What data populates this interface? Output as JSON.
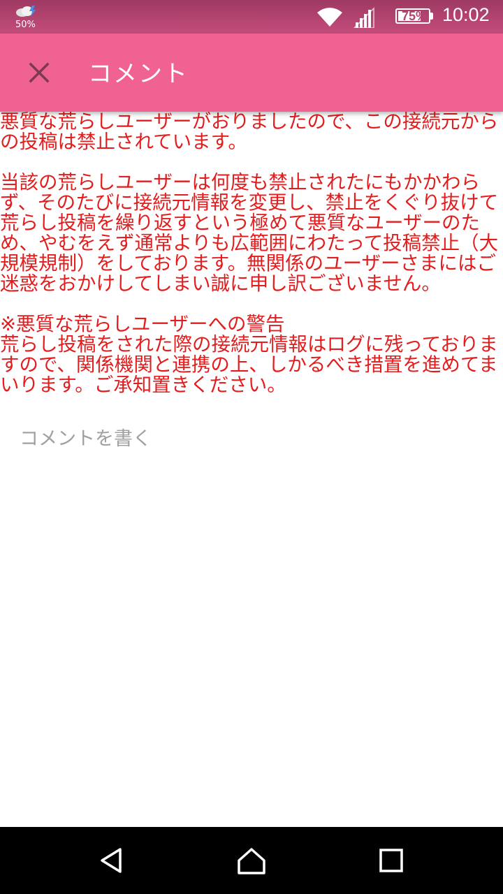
{
  "status_bar": {
    "weather_percent": "50%",
    "battery_percent": "75%",
    "battery_level": 0.75,
    "time": "10:02",
    "icons": [
      "weather-icon",
      "wifi-icon",
      "signal-icon",
      "battery-icon"
    ]
  },
  "app_bar": {
    "title": "コメント",
    "close_icon": "close-icon",
    "color": "#f06292"
  },
  "notice": {
    "color": "#e31d1d",
    "paragraph1": "悪質な荒らしユーザーがおりましたので、この接続元からの投稿は禁止されています。",
    "paragraph2": "当該の荒らしユーザーは何度も禁止されたにもかかわらず、そのたびに接続元情報を変更し、禁止をくぐり抜けて荒らし投稿を繰り返すという極めて悪質なユーザーのため、やむをえず通常よりも広範囲にわたって投稿禁止（大規模規制）をしております。無関係のユーザーさまにはご迷惑をおかけしてしまい誠に申し訳ございません。",
    "warning_title": "※悪質な荒らしユーザーへの警告",
    "warning_body": "荒らし投稿をされた際の接続元情報はログに残っておりますので、関係機関と連携の上、しかるべき措置を進めてまいります。ご承知置きください。"
  },
  "comment": {
    "placeholder": "コメントを書く",
    "value": ""
  },
  "nav_bar": {
    "icons": [
      "back-icon",
      "home-icon",
      "recents-icon"
    ]
  }
}
